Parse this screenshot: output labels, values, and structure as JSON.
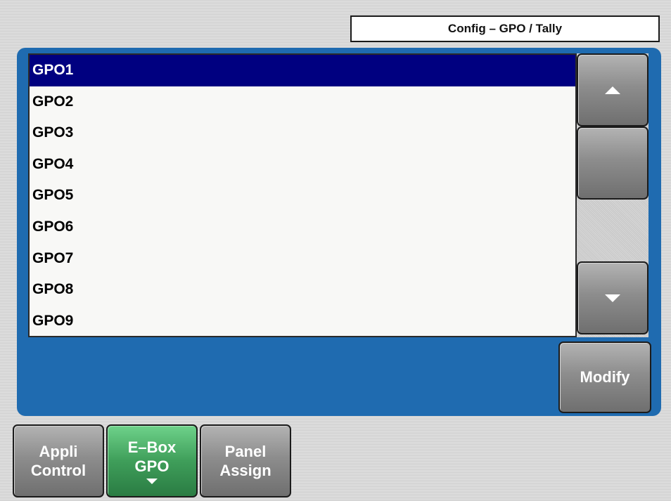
{
  "header": {
    "title": "Config – GPO / Tally"
  },
  "gpo_list": {
    "items": [
      "GPO1",
      "GPO2",
      "GPO3",
      "GPO4",
      "GPO5",
      "GPO6",
      "GPO7",
      "GPO8",
      "GPO9"
    ],
    "selected": "GPO1"
  },
  "scrollbar": {
    "up_icon": "triangle-up-icon",
    "down_icon": "triangle-down-icon"
  },
  "actions": {
    "modify_label": "Modify"
  },
  "tabs": [
    {
      "line1": "Appli",
      "line2": "Control"
    },
    {
      "line1": "E–Box",
      "line2": "GPO"
    },
    {
      "line1": "Panel",
      "line2": "Assign"
    }
  ],
  "colors": {
    "panel_blue": "#1f6bb0",
    "selection_navy": "#000080",
    "active_tab_green": "#3f9e5a"
  }
}
